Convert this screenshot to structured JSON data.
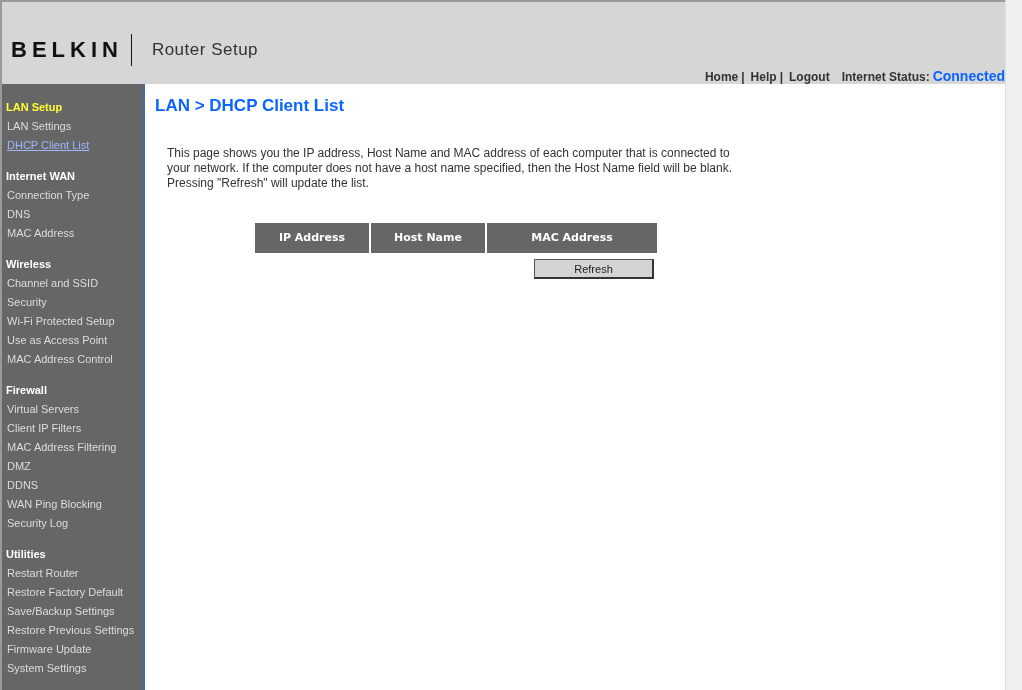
{
  "header": {
    "logo": "BELKIN",
    "title": "Router Setup",
    "links": [
      "Home",
      "Help",
      "Logout"
    ],
    "separator": "|",
    "status_label": "Internet Status:",
    "status_value": "Connected"
  },
  "sidebar": [
    {
      "heading": "LAN Setup",
      "selected": true,
      "items": [
        {
          "label": "LAN Settings",
          "selected": false
        },
        {
          "label": "DHCP Client List",
          "selected": true
        }
      ]
    },
    {
      "heading": "Internet WAN",
      "selected": false,
      "items": [
        {
          "label": "Connection Type",
          "selected": false
        },
        {
          "label": "DNS",
          "selected": false
        },
        {
          "label": "MAC Address",
          "selected": false
        }
      ]
    },
    {
      "heading": "Wireless",
      "selected": false,
      "items": [
        {
          "label": "Channel and SSID",
          "selected": false
        },
        {
          "label": "Security",
          "selected": false
        },
        {
          "label": "Wi-Fi Protected Setup",
          "selected": false
        },
        {
          "label": "Use as Access Point",
          "selected": false
        },
        {
          "label": "MAC Address Control",
          "selected": false
        }
      ]
    },
    {
      "heading": "Firewall",
      "selected": false,
      "items": [
        {
          "label": "Virtual Servers",
          "selected": false
        },
        {
          "label": "Client IP Filters",
          "selected": false
        },
        {
          "label": "MAC Address Filtering",
          "selected": false
        },
        {
          "label": "DMZ",
          "selected": false
        },
        {
          "label": "DDNS",
          "selected": false
        },
        {
          "label": "WAN Ping Blocking",
          "selected": false
        },
        {
          "label": "Security Log",
          "selected": false
        }
      ]
    },
    {
      "heading": "Utilities",
      "selected": false,
      "items": [
        {
          "label": "Restart Router",
          "selected": false
        },
        {
          "label": "Restore Factory Default",
          "selected": false
        },
        {
          "label": "Save/Backup Settings",
          "selected": false
        },
        {
          "label": "Restore Previous Settings",
          "selected": false
        },
        {
          "label": "Firmware Update",
          "selected": false
        },
        {
          "label": "System Settings",
          "selected": false
        }
      ]
    }
  ],
  "content": {
    "title": "LAN > DHCP Client List",
    "description": [
      "This page shows you the IP address, Host Name and MAC address of each computer that is connected to",
      "your network. If the computer does not have a host name specified, then the Host Name field will be blank.",
      "Pressing \"Refresh\" will update the list."
    ],
    "table": {
      "columns": [
        "IP Address",
        "Host Name",
        "MAC Address"
      ]
    },
    "button": "Refresh"
  }
}
